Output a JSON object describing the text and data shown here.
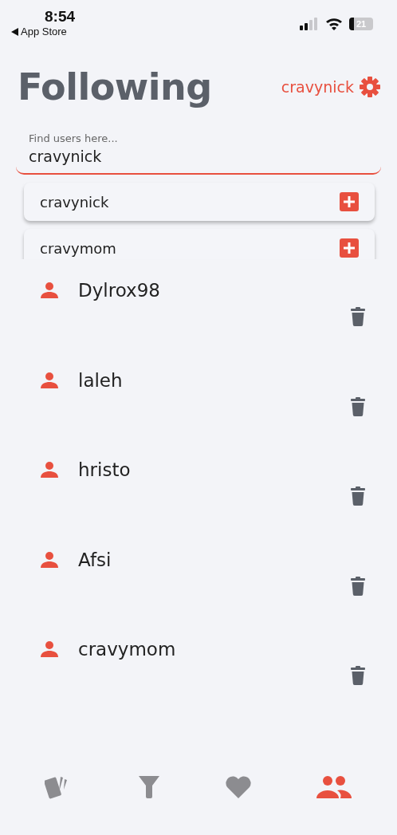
{
  "status_bar": {
    "time": "8:54",
    "back_label": "App Store",
    "battery": "21"
  },
  "header": {
    "title": "Following",
    "username": "cravynick"
  },
  "search": {
    "placeholder": "Find users here...",
    "value": "cravynick"
  },
  "suggestions": [
    {
      "name": "cravynick"
    },
    {
      "name": "cravymom"
    }
  ],
  "following": [
    {
      "name": "Dylrox98"
    },
    {
      "name": "laleh"
    },
    {
      "name": "hristo"
    },
    {
      "name": "Afsi"
    },
    {
      "name": "cravymom"
    }
  ],
  "tab_bar": [
    {
      "kind": "cards",
      "selected": false
    },
    {
      "kind": "filter",
      "selected": false
    },
    {
      "kind": "heart",
      "selected": false
    },
    {
      "kind": "people",
      "selected": true
    }
  ]
}
